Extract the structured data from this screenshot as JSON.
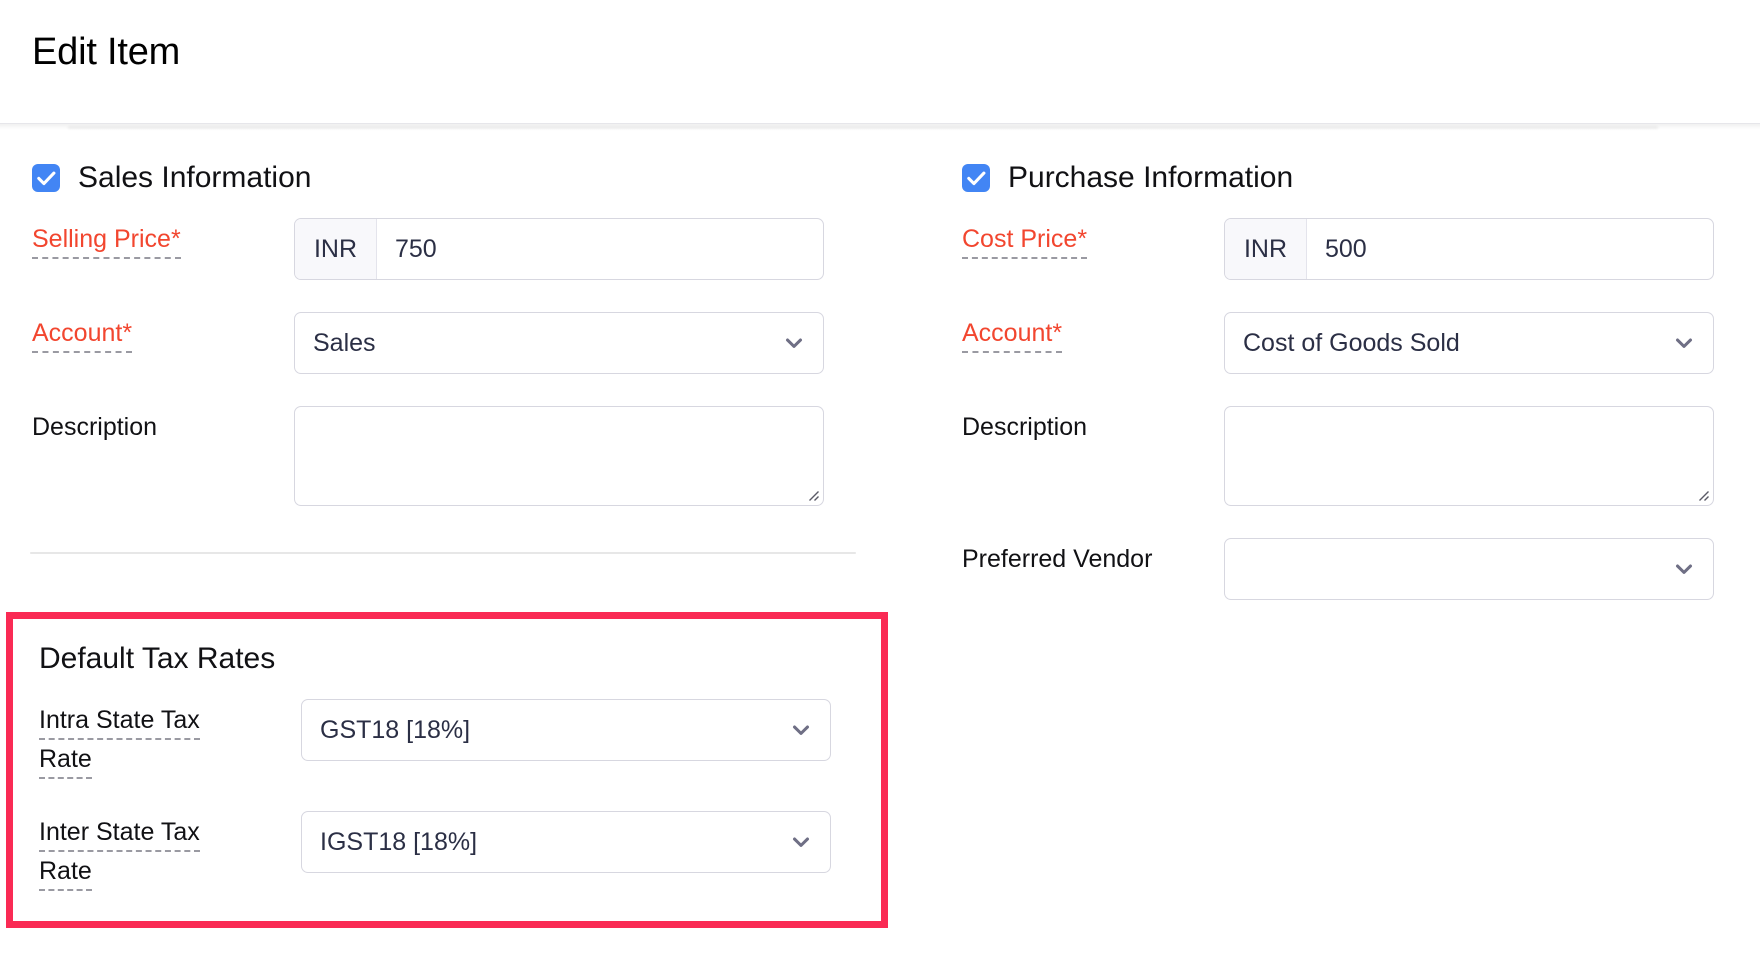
{
  "header": {
    "title": "Edit Item"
  },
  "sales": {
    "checkbox_checked": true,
    "section_title": "Sales Information",
    "selling_price": {
      "label": "Selling Price",
      "required_mark": "*",
      "currency": "INR",
      "value": "750",
      "placeholder": ""
    },
    "account": {
      "label": "Account",
      "required_mark": "*",
      "value": "Sales"
    },
    "description": {
      "label": "Description",
      "value": "",
      "placeholder": ""
    }
  },
  "purchase": {
    "checkbox_checked": true,
    "section_title": "Purchase Information",
    "cost_price": {
      "label": "Cost Price",
      "required_mark": "*",
      "currency": "INR",
      "value": "500",
      "placeholder": ""
    },
    "account": {
      "label": "Account",
      "required_mark": "*",
      "value": "Cost of Goods Sold"
    },
    "description": {
      "label": "Description",
      "value": "",
      "placeholder": ""
    },
    "preferred_vendor": {
      "label": "Preferred Vendor",
      "value": ""
    }
  },
  "default_tax_rates": {
    "section_title": "Default Tax Rates",
    "intra_state": {
      "label_line1": "Intra State Tax",
      "label_line2": "Rate",
      "value": "GST18 [18%]"
    },
    "inter_state": {
      "label_line1": "Inter State Tax",
      "label_line2": "Rate",
      "value": "IGST18 [18%]"
    }
  },
  "icons": {
    "checkbox_check": "check-icon",
    "dropdown_chevron": "chevron-down-icon",
    "resize_grip": "resize-grip-icon"
  },
  "colors": {
    "checkbox_blue": "#4285F4",
    "required_red": "#F2462F",
    "highlight_pink": "#FA2A54",
    "field_border": "#D7D7E0",
    "text_dark": "#2B2F45",
    "chevron_grey": "#6F6F85"
  }
}
